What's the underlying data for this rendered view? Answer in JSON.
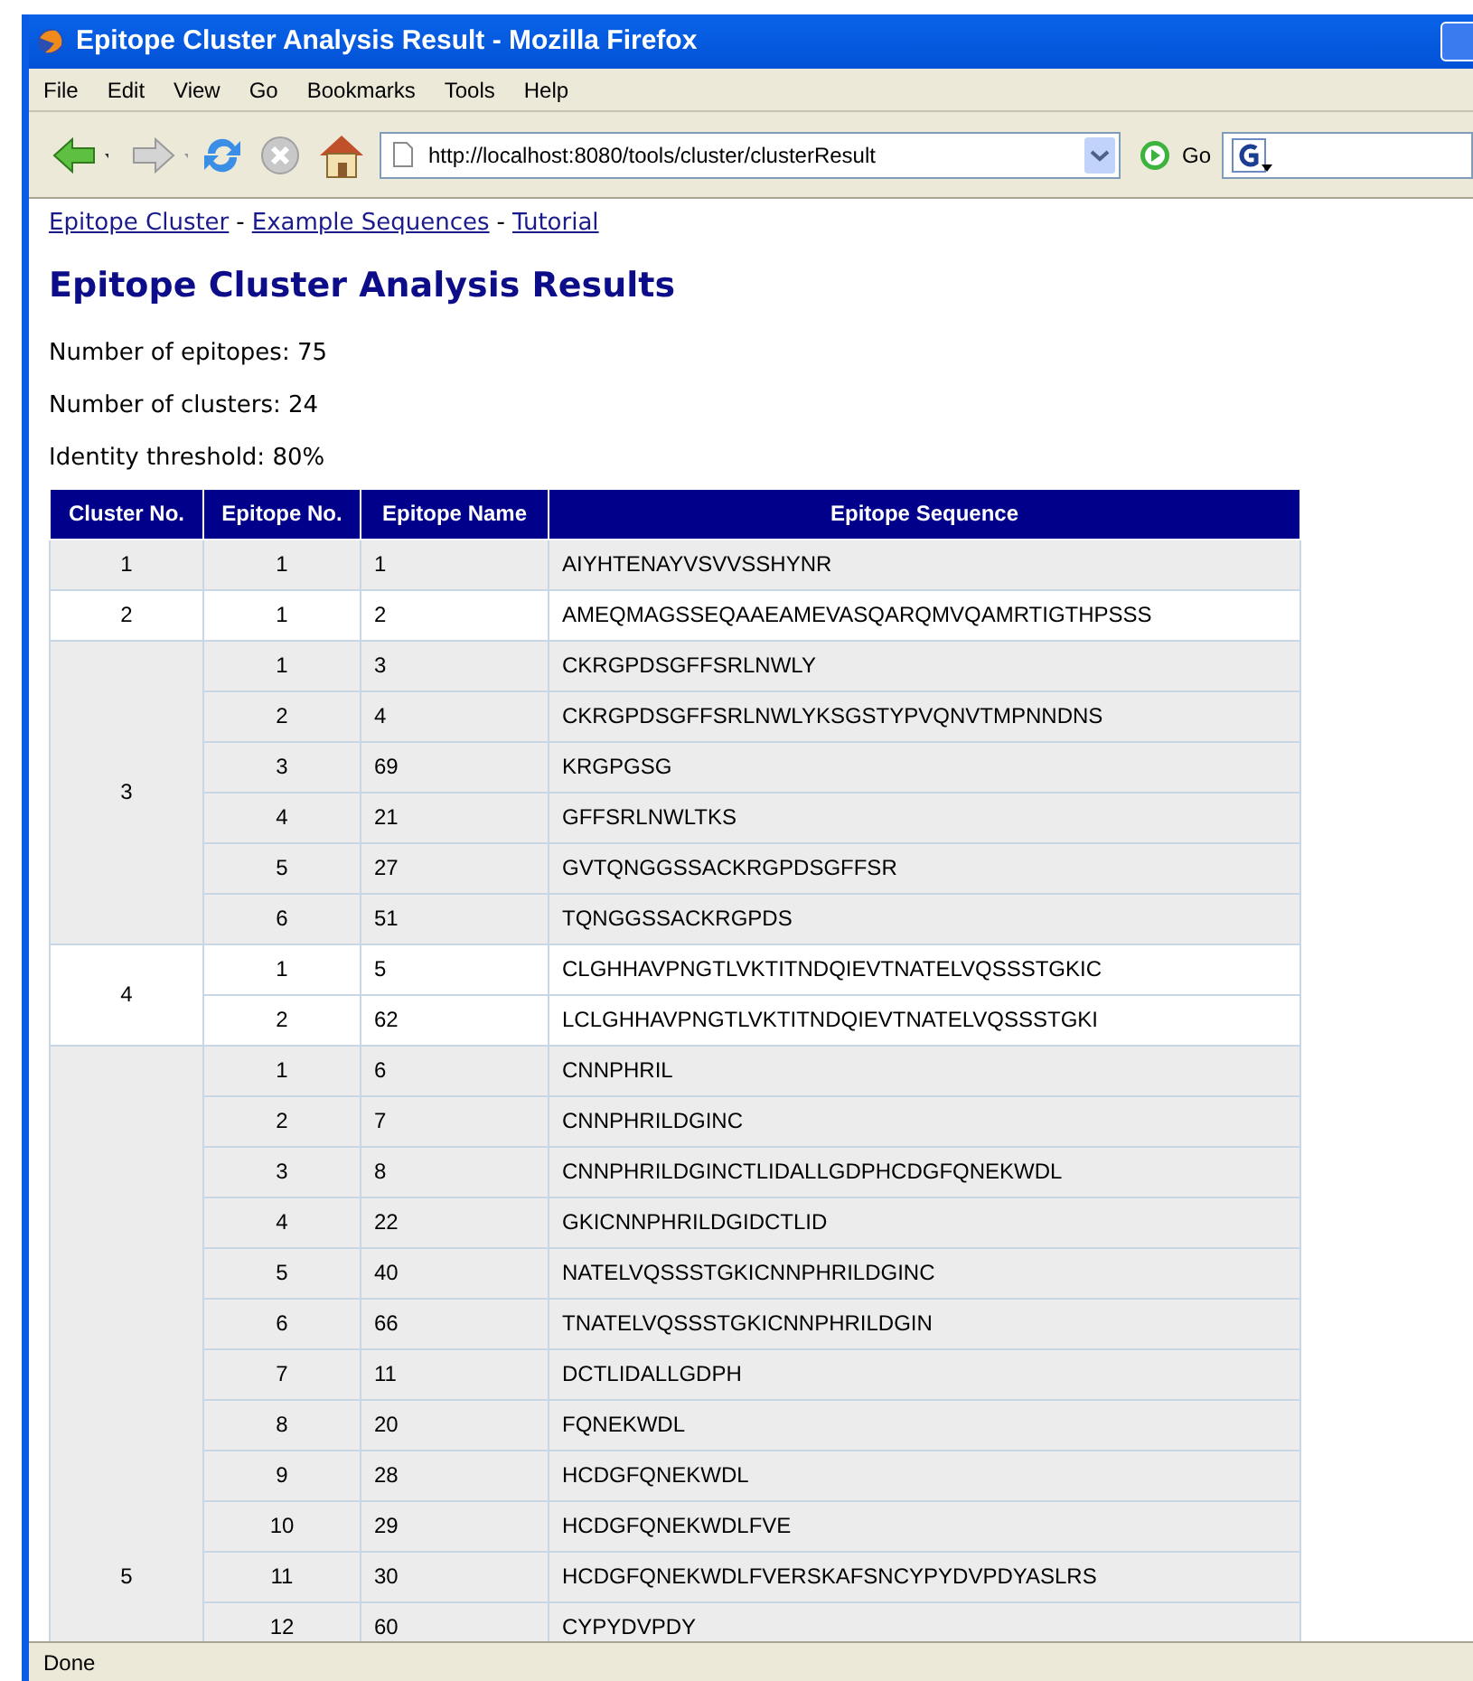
{
  "window": {
    "title": "Epitope Cluster Analysis Result - Mozilla Firefox"
  },
  "menu": [
    "File",
    "Edit",
    "View",
    "Go",
    "Bookmarks",
    "Tools",
    "Help"
  ],
  "toolbar": {
    "url": "http://localhost:8080/tools/cluster/clusterResult",
    "go": "Go"
  },
  "nav_links": [
    {
      "label": "Epitope Cluster"
    },
    {
      "label": "Example Sequences"
    },
    {
      "label": "Tutorial"
    }
  ],
  "nav_separator": "-",
  "heading": "Epitope Cluster Analysis Results",
  "summary": [
    "Number of epitopes: 75",
    "Number of clusters: 24",
    "Identity threshold: 80%"
  ],
  "table": {
    "columns": [
      "Cluster No.",
      "Epitope No.",
      "Epitope Name",
      "Epitope Sequence"
    ],
    "clusters": [
      {
        "cluster": "1",
        "epitopes": [
          [
            "1",
            "1",
            "AIYHTENAYVSVVSSHYNR"
          ]
        ]
      },
      {
        "cluster": "2",
        "epitopes": [
          [
            "1",
            "2",
            "AMEQMAGSSEQAAEAMEVASQARQMVQAMRTIGTHPSSS"
          ]
        ]
      },
      {
        "cluster": "3",
        "epitopes": [
          [
            "1",
            "3",
            "CKRGPDSGFFSRLNWLY"
          ],
          [
            "2",
            "4",
            "CKRGPDSGFFSRLNWLYKSGSTYPVQNVTMPNNDNS"
          ],
          [
            "3",
            "69",
            "KRGPGSG"
          ],
          [
            "4",
            "21",
            "GFFSRLNWLTKS"
          ],
          [
            "5",
            "27",
            "GVTQNGGSSACKRGPDSGFFSR"
          ],
          [
            "6",
            "51",
            "TQNGGSSACKRGPDS"
          ]
        ]
      },
      {
        "cluster": "4",
        "epitopes": [
          [
            "1",
            "5",
            "CLGHHAVPNGTLVKTITNDQIEVTNATELVQSSSTGKIC"
          ],
          [
            "2",
            "62",
            "LCLGHHAVPNGTLVKTITNDQIEVTNATELVQSSSTGKI"
          ]
        ]
      },
      {
        "cluster": "5",
        "epitopes": [
          [
            "1",
            "6",
            "CNNPHRIL"
          ],
          [
            "2",
            "7",
            "CNNPHRILDGINC"
          ],
          [
            "3",
            "8",
            "CNNPHRILDGINCTLIDALLGDPHCDGFQNEKWDL"
          ],
          [
            "4",
            "22",
            "GKICNNPHRILDGIDCTLID"
          ],
          [
            "5",
            "40",
            "NATELVQSSSTGKICNNPHRILDGINC"
          ],
          [
            "6",
            "66",
            "TNATELVQSSSTGKICNNPHRILDGIN"
          ],
          [
            "7",
            "11",
            "DCTLIDALLGDPH"
          ],
          [
            "8",
            "20",
            "FQNEKWDL"
          ],
          [
            "9",
            "28",
            "HCDGFQNEKWDL"
          ],
          [
            "10",
            "29",
            "HCDGFQNEKWDLFVE"
          ],
          [
            "11",
            "30",
            "HCDGFQNEKWDLFVERSKAFSNCYPYDVPDYASLRS"
          ],
          [
            "12",
            "60",
            "CYPYDVPDY"
          ]
        ]
      }
    ]
  },
  "status_bar": "Done"
}
